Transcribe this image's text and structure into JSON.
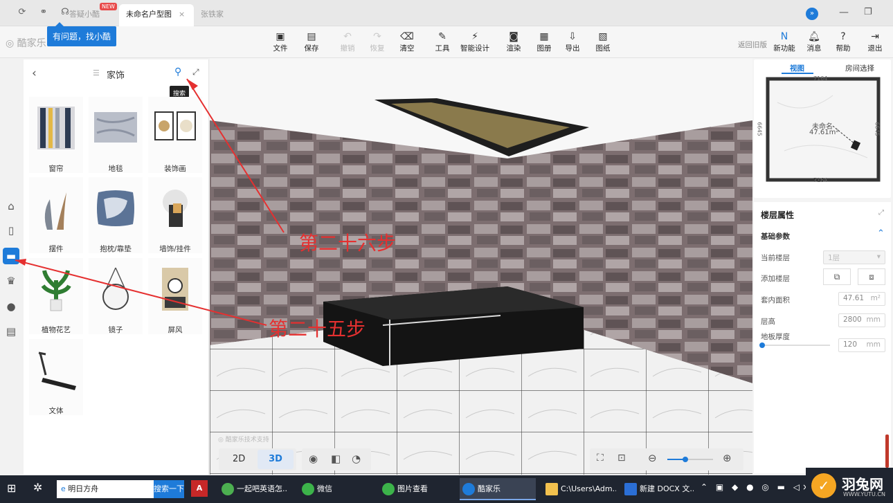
{
  "tabs": {
    "helper_label": "答疑小酷",
    "new_badge": "NEW",
    "active_tab": "未命名户型图",
    "other_tab": "张铁家园-...",
    "tooltip": "有问题，找小酷"
  },
  "app": {
    "logo": "酷家乐"
  },
  "toolbar": {
    "file": "文件",
    "save": "保存",
    "undo": "撤销",
    "redo": "恢复",
    "clear": "清空",
    "tools": "工具",
    "smart": "智能设计",
    "render": "渲染",
    "album": "图册",
    "export": "导出",
    "drawing": "图纸",
    "old_version": "返回旧版",
    "new_feature": "新功能",
    "message": "消息",
    "help": "帮助",
    "exit": "退出"
  },
  "panel": {
    "title": "家饰",
    "search_tooltip": "搜索",
    "categories": [
      {
        "label": "窗帘"
      },
      {
        "label": "地毯"
      },
      {
        "label": "装饰画"
      },
      {
        "label": "摆件"
      },
      {
        "label": "抱枕/靠垫"
      },
      {
        "label": "墙饰/挂件"
      },
      {
        "label": "植物花艺"
      },
      {
        "label": "镜子"
      },
      {
        "label": "屏风"
      },
      {
        "label": "文体"
      }
    ]
  },
  "annotations": {
    "step26": "第二十六步",
    "step25": "第二十五步"
  },
  "minimap": {
    "tab_view": "视图",
    "tab_room": "房间选择",
    "room_name": "未命名",
    "room_area": "47.61m²",
    "dim_top": "7164",
    "dim_bottom": "7164",
    "dim_left": "6645",
    "dim_right": "6645"
  },
  "props": {
    "title": "楼层属性",
    "section": "基础参数",
    "current_floor_label": "当前楼层",
    "current_floor_value": "1层",
    "add_floor_label": "添加楼层",
    "area_label": "套内面积",
    "area_value": "47.61",
    "area_unit": "m²",
    "height_label": "层高",
    "height_value": "2800",
    "height_unit": "mm",
    "thickness_label": "地板厚度",
    "thickness_value": "120",
    "thickness_unit": "mm",
    "thickness_slider": 0.0
  },
  "view": {
    "mode_2d": "2D",
    "mode_3d": "3D",
    "active": "3D",
    "watermark": "酷家乐技术支持",
    "zoom": 0.4
  },
  "taskbar": {
    "search_placeholder": "明日方舟",
    "search_button": "搜索一下",
    "items": [
      "一起吧英语怎...",
      "微信",
      "图片查看",
      "酷家乐",
      "C:\\Users\\Adm...",
      "新建 DOCX 文..."
    ],
    "brand": "羽兔网",
    "brand_url": "WWW.YUTU.CN"
  },
  "colors": {
    "accent": "#1e7bd9",
    "annotation": "#e53030",
    "taskbar": "#1f2530"
  }
}
